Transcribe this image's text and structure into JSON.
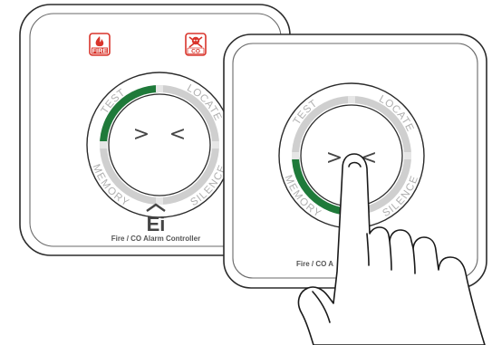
{
  "brand": {
    "logo_text": "Ei",
    "product_caption": "Fire / CO Alarm Controller",
    "product_caption_partial_left": "Fire / CO A",
    "product_caption_partial_right": "ller"
  },
  "indicators": {
    "fire": {
      "label": "FIRE",
      "icon": "flame-icon"
    },
    "co": {
      "label": "CO",
      "icon": "skull-crossbones-icon"
    }
  },
  "ring_labels": {
    "top_left": "TEST",
    "top_right": "LOCATE",
    "bottom_left": "MEMORY",
    "bottom_right": "SILENCE"
  },
  "center_glyphs": {
    "left": ">",
    "right": "<"
  },
  "colors": {
    "accent_green": "#1f7a3a",
    "indicator_red": "#d9342b",
    "ring_gray": "#cfcfcf",
    "outline": "#333333"
  }
}
